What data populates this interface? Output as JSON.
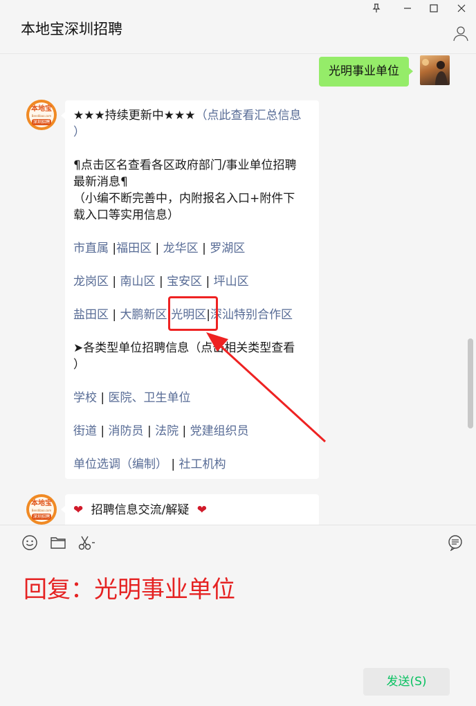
{
  "window": {
    "title": "本地宝深圳招聘",
    "controls": [
      "pin-icon",
      "minimize-icon",
      "maximize-icon",
      "close-icon"
    ]
  },
  "my_message": {
    "text": "光明事业单位"
  },
  "bot_avatar": {
    "line1": "本地宝",
    "line2": "Bendibao.com",
    "line3": "深圳招聘"
  },
  "bot_message": {
    "line1_text": "★★★持续更新中★★★",
    "line1_link": "（点此查看汇总信息",
    "line1_cont": "）",
    "intro_1": "¶点击区名查看各区政府部门/事业单位招聘",
    "intro_2": "最新消息¶",
    "intro_3": "（小编不断完善中，内附报名入口+附件下",
    "intro_4": "载入口等实用信息）",
    "districts": {
      "d1": "市直属",
      "d2": "福田区",
      "d3": "龙华区",
      "d4": "罗湖区",
      "d5": "龙岗区",
      "d6": "南山区",
      "d7": "宝安区",
      "d8": "坪山区",
      "d9": "盐田区",
      "d10": "大鹏新区",
      "d11": "光明区",
      "d12": "深汕特别合作区"
    },
    "types_heading": "➤各类型单位招聘信息（点击相关类型查看",
    "types_heading_cont": "）",
    "types": {
      "t1": "学校",
      "t2": "医院、卫生单位",
      "t3": "街道",
      "t4": "消防员",
      "t5": "法院",
      "t6": "党建组织员",
      "t7": "单位选调（编制）",
      "t8": "社工机构"
    }
  },
  "bot_message_2": {
    "text": "招聘信息交流/解疑"
  },
  "composer": {
    "tools": [
      "emoji-icon",
      "folder-icon",
      "scissors-icon",
      "chat-history-icon"
    ],
    "reply": "回复：光明事业单位",
    "send_label": "发送(S)"
  },
  "colors": {
    "accent_green": "#07c160",
    "bubble_green": "#95ec69",
    "link": "#576b95",
    "annotation_red": "#e52222"
  }
}
